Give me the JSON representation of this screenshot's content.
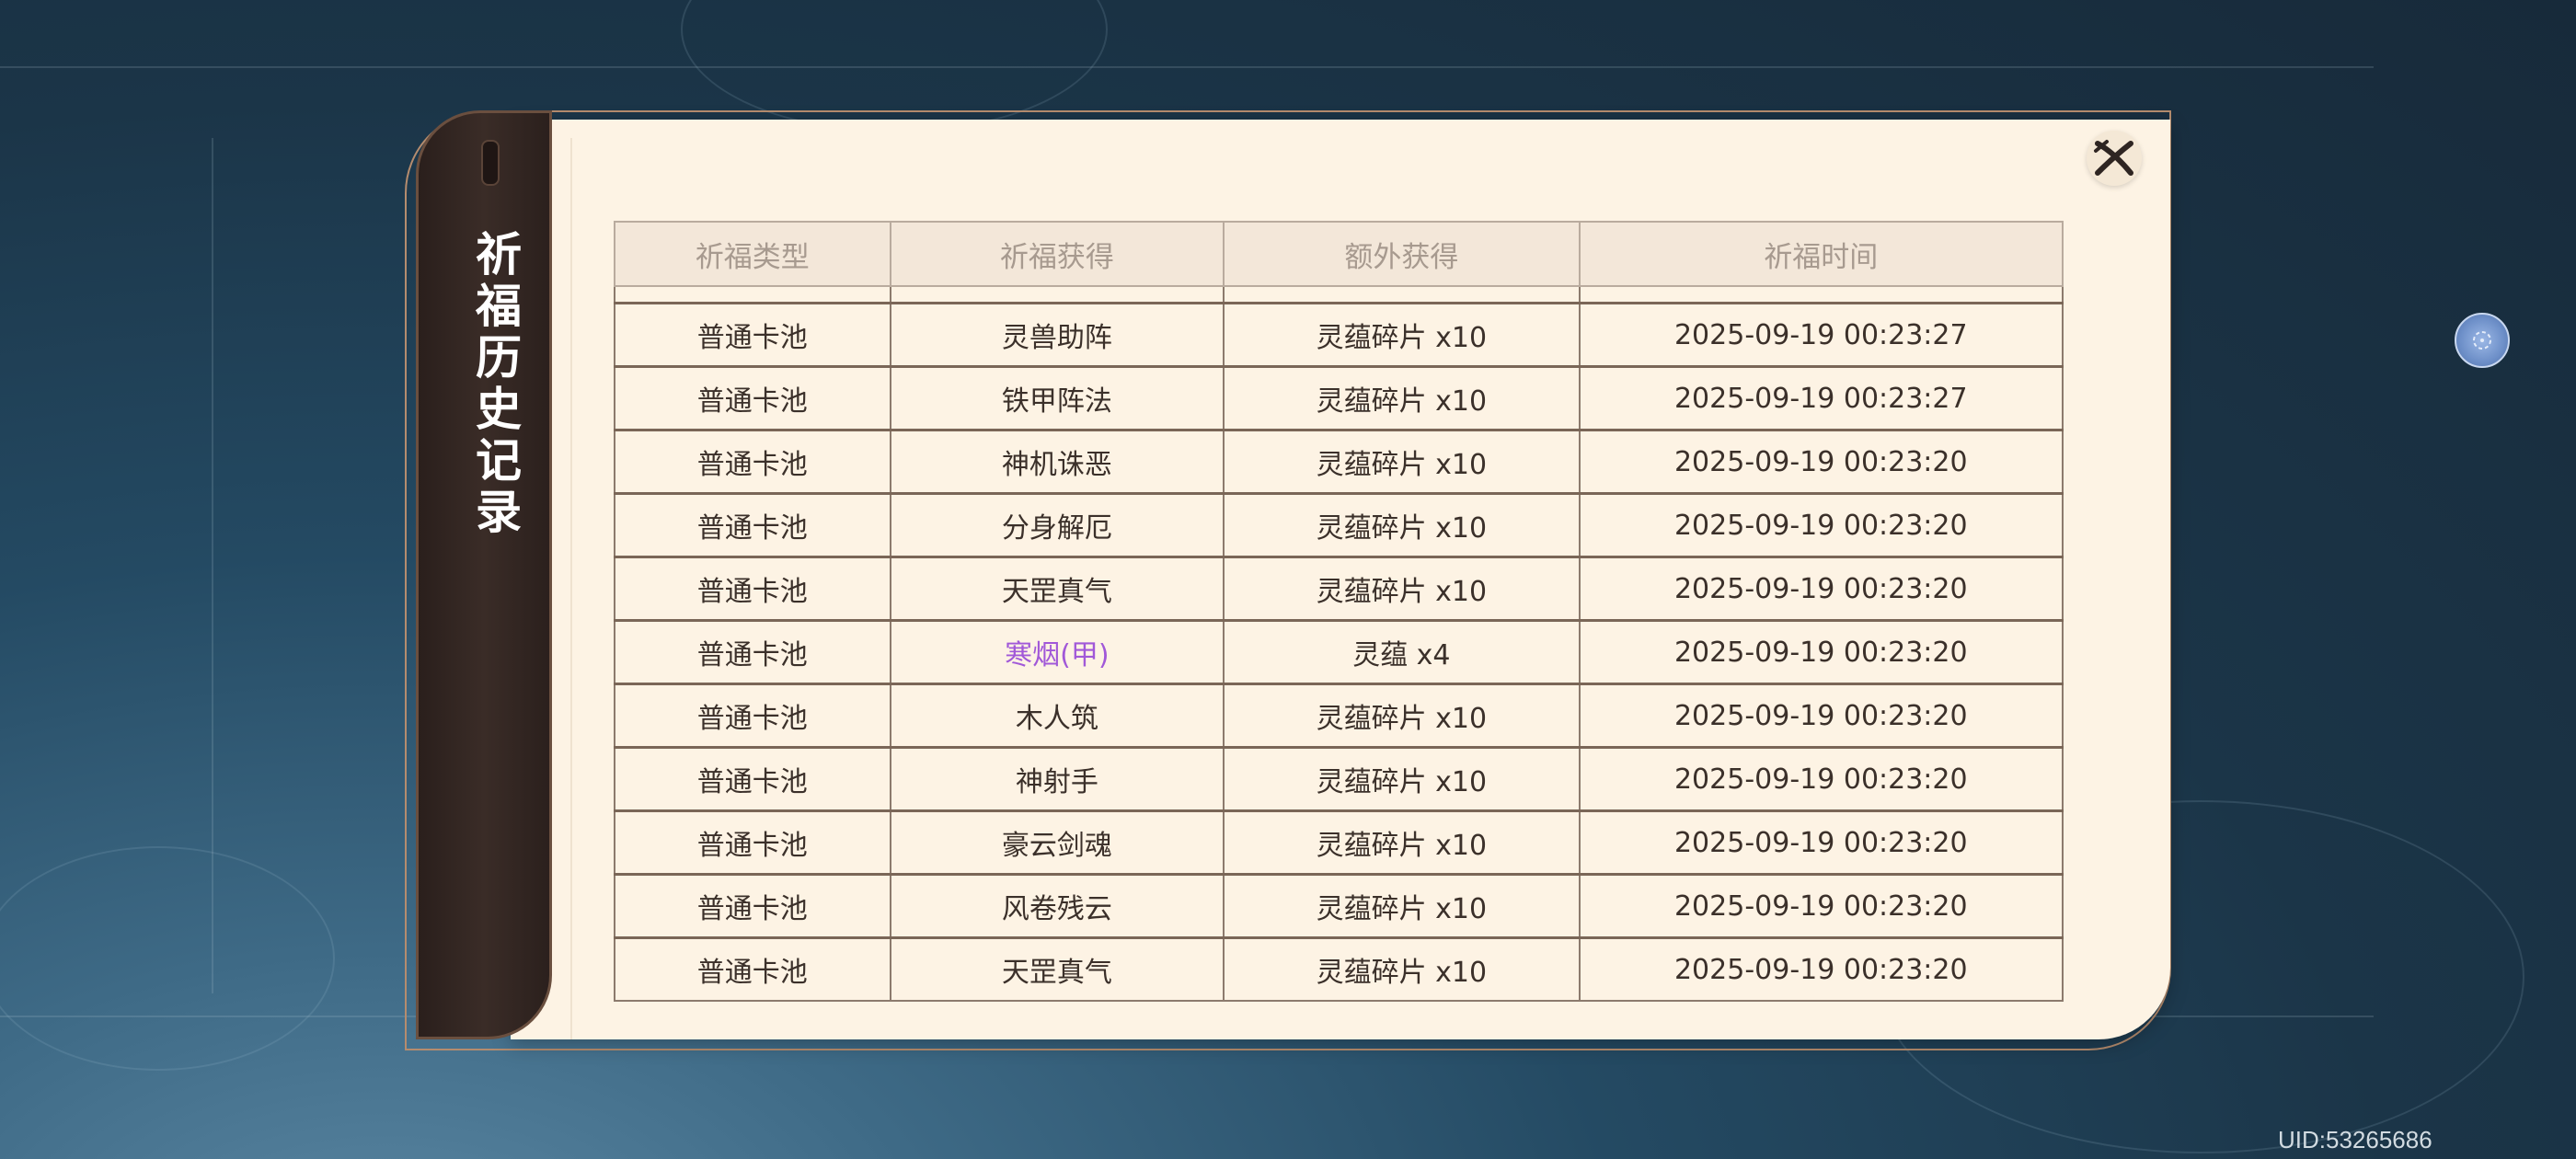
{
  "panel": {
    "title": "祈福历史记录"
  },
  "table": {
    "headers": [
      "祈福类型",
      "祈福获得",
      "额外获得",
      "祈福时间"
    ],
    "rows": [
      {
        "type": "普通卡池",
        "reward": "灵兽助阵",
        "extra": "灵蕴碎片 x10",
        "time": "2025-09-19 00:23:27",
        "highlight": false
      },
      {
        "type": "普通卡池",
        "reward": "铁甲阵法",
        "extra": "灵蕴碎片 x10",
        "time": "2025-09-19 00:23:27",
        "highlight": false
      },
      {
        "type": "普通卡池",
        "reward": "神机诛恶",
        "extra": "灵蕴碎片 x10",
        "time": "2025-09-19 00:23:20",
        "highlight": false
      },
      {
        "type": "普通卡池",
        "reward": "分身解厄",
        "extra": "灵蕴碎片 x10",
        "time": "2025-09-19 00:23:20",
        "highlight": false
      },
      {
        "type": "普通卡池",
        "reward": "天罡真气",
        "extra": "灵蕴碎片 x10",
        "time": "2025-09-19 00:23:20",
        "highlight": false
      },
      {
        "type": "普通卡池",
        "reward": "寒烟(甲)",
        "extra": "灵蕴 x4",
        "time": "2025-09-19 00:23:20",
        "highlight": true
      },
      {
        "type": "普通卡池",
        "reward": "木人筑",
        "extra": "灵蕴碎片 x10",
        "time": "2025-09-19 00:23:20",
        "highlight": false
      },
      {
        "type": "普通卡池",
        "reward": "神射手",
        "extra": "灵蕴碎片 x10",
        "time": "2025-09-19 00:23:20",
        "highlight": false
      },
      {
        "type": "普通卡池",
        "reward": "豪云剑魂",
        "extra": "灵蕴碎片 x10",
        "time": "2025-09-19 00:23:20",
        "highlight": false
      },
      {
        "type": "普通卡池",
        "reward": "风卷残云",
        "extra": "灵蕴碎片 x10",
        "time": "2025-09-19 00:23:20",
        "highlight": false
      },
      {
        "type": "普通卡池",
        "reward": "天罡真气",
        "extra": "灵蕴碎片 x10",
        "time": "2025-09-19 00:23:20",
        "highlight": false
      }
    ]
  },
  "colors": {
    "highlight": "#a158d8",
    "panel_bg": "#fdf3e4",
    "spine_bg": "#2a1f1c"
  },
  "icons": {
    "close": "close-icon",
    "side": "orb-icon"
  },
  "footer": {
    "uid": "UID:53265686"
  }
}
